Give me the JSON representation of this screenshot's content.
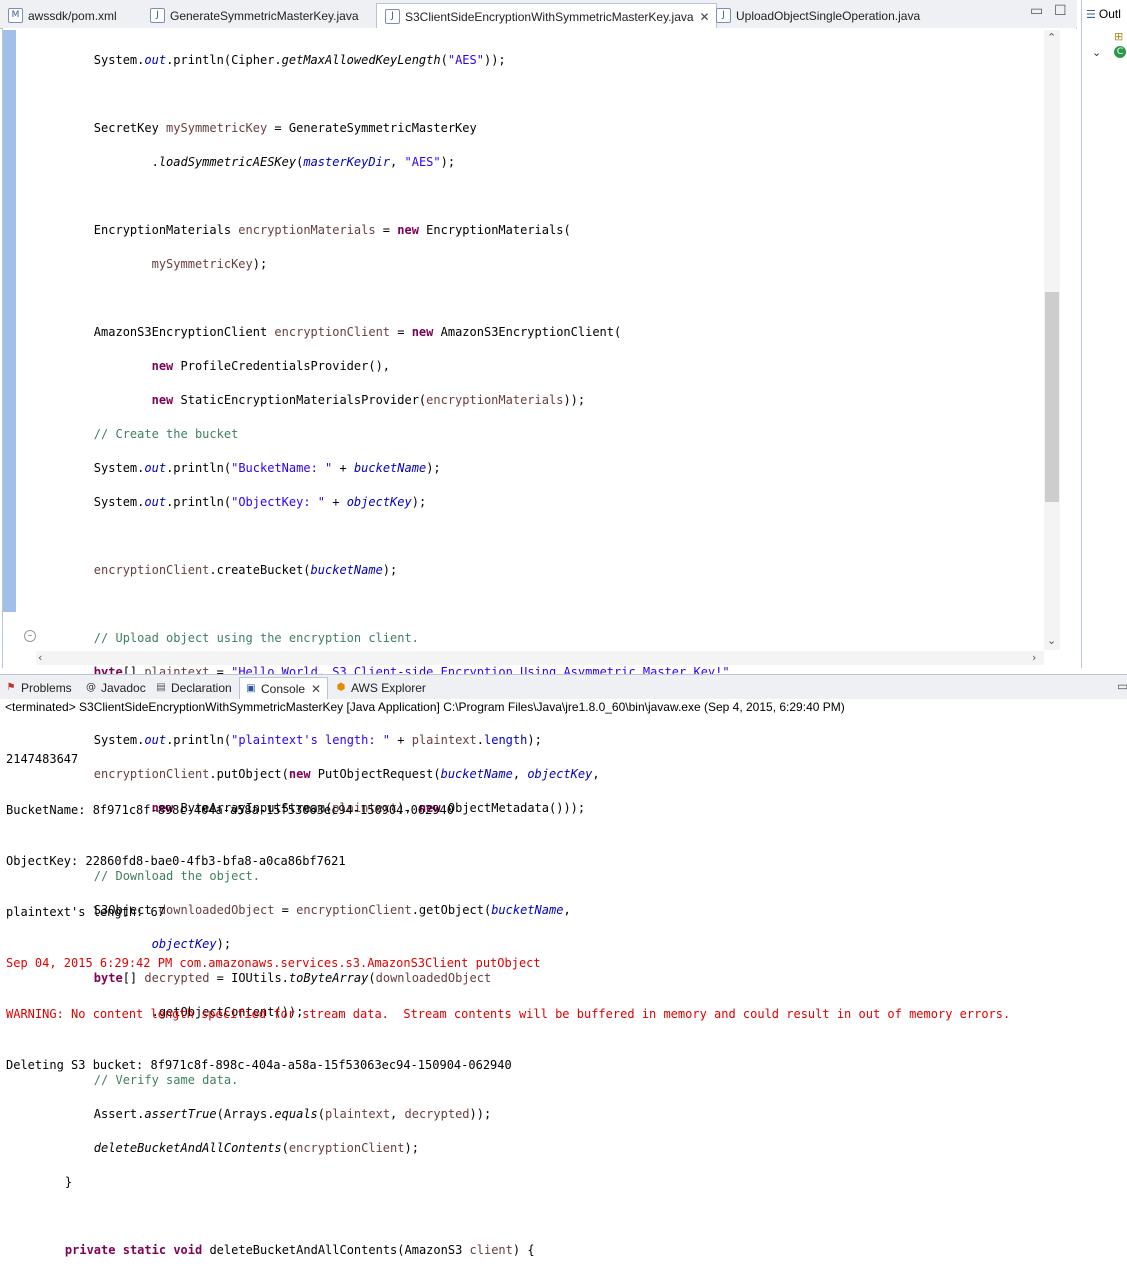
{
  "editor_tabs": [
    {
      "label": "awssdk/pom.xml",
      "icon": "maven-icon",
      "active": false
    },
    {
      "label": "GenerateSymmetricMasterKey.java",
      "icon": "java-file-icon",
      "active": false
    },
    {
      "label": "S3ClientSideEncryptionWithSymmetricMasterKey.java",
      "icon": "java-file-icon",
      "active": true
    },
    {
      "label": "UploadObjectSingleOperation.java",
      "icon": "java-file-icon",
      "active": false
    }
  ],
  "outline": {
    "label": "Outl"
  },
  "code_lines": [
    "        System.out.println(Cipher.getMaxAllowedKeyLength(\"AES\"));",
    "",
    "        SecretKey mySymmetricKey = GenerateSymmetricMasterKey",
    "                .loadSymmetricAESKey(masterKeyDir, \"AES\");",
    "",
    "        EncryptionMaterials encryptionMaterials = new EncryptionMaterials(",
    "                mySymmetricKey);",
    "",
    "        AmazonS3EncryptionClient encryptionClient = new AmazonS3EncryptionClient(",
    "                new ProfileCredentialsProvider(),",
    "                new StaticEncryptionMaterialsProvider(encryptionMaterials));",
    "        // Create the bucket",
    "        System.out.println(\"BucketName: \" + bucketName);",
    "        System.out.println(\"ObjectKey: \" + objectKey);",
    "",
    "        encryptionClient.createBucket(bucketName);",
    "",
    "        // Upload object using the encryption client.",
    "        byte[] plaintext = \"Hello World, S3 Client-side Encryption Using Asymmetric Master Key!\"",
    "                .getBytes();",
    "        System.out.println(\"plaintext's length: \" + plaintext.length);",
    "        encryptionClient.putObject(new PutObjectRequest(bucketName, objectKey,",
    "                new ByteArrayInputStream(plaintext), new ObjectMetadata()));",
    "",
    "        // Download the object.",
    "        S3Object downloadedObject = encryptionClient.getObject(bucketName,",
    "                objectKey);",
    "        byte[] decrypted = IOUtils.toByteArray(downloadedObject",
    "                .getObjectContent());",
    "",
    "        // Verify same data.",
    "        Assert.assertTrue(Arrays.equals(plaintext, decrypted));",
    "        deleteBucketAndAllContents(encryptionClient);",
    "    }",
    "",
    "    private static void deleteBucketAndAllContents(AmazonS3 client) {"
  ],
  "view_tabs": [
    {
      "label": "Problems",
      "icon": "problems-icon",
      "active": false
    },
    {
      "label": "Javadoc",
      "icon": "javadoc-icon",
      "active": false
    },
    {
      "label": "Declaration",
      "icon": "declaration-icon",
      "active": false
    },
    {
      "label": "Console",
      "icon": "console-icon",
      "active": true
    },
    {
      "label": "AWS Explorer",
      "icon": "aws-explorer-icon",
      "active": false
    }
  ],
  "console": {
    "status": "<terminated> S3ClientSideEncryptionWithSymmetricMasterKey [Java Application] C:\\Program Files\\Java\\jre1.8.0_60\\bin\\javaw.exe (Sep 4, 2015, 6:29:40 PM)",
    "lines": [
      {
        "text": "2147483647",
        "type": "out"
      },
      {
        "text": "BucketName: 8f971c8f-898c-404a-a58a-15f53063ec94-150904-062940",
        "type": "out"
      },
      {
        "text": "ObjectKey: 22860fd8-bae0-4fb3-bfa8-a0ca86bf7621",
        "type": "out"
      },
      {
        "text": "plaintext's length: 67",
        "type": "out"
      },
      {
        "text": "Sep 04, 2015 6:29:42 PM com.amazonaws.services.s3.AmazonS3Client putObject",
        "type": "err"
      },
      {
        "text": "WARNING: No content length specified for stream data.  Stream contents will be buffered in memory and could result in out of memory errors.",
        "type": "err"
      },
      {
        "text": "Deleting S3 bucket: 8f971c8f-898c-404a-a58a-15f53063ec94-150904-062940",
        "type": "out"
      }
    ]
  },
  "colors": {
    "keyword": "#7f0055",
    "string": "#2a00ff",
    "comment": "#3f7f5f",
    "field": "#0000c0",
    "error": "#e00000"
  }
}
